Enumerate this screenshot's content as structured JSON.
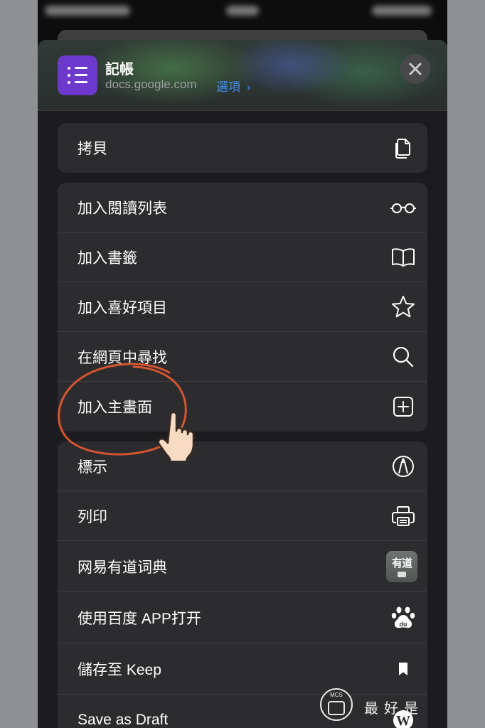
{
  "share_sheet": {
    "app_title": "記帳",
    "app_domain": "docs.google.com",
    "options_label": "選項",
    "options_chevron": "›",
    "close_symbol": "✕"
  },
  "groups": [
    {
      "items": [
        {
          "label": "拷貝",
          "icon": "copy-icon"
        }
      ]
    },
    {
      "items": [
        {
          "label": "加入閱讀列表",
          "icon": "glasses-icon"
        },
        {
          "label": "加入書籤",
          "icon": "book-icon"
        },
        {
          "label": "加入喜好項目",
          "icon": "star-icon"
        },
        {
          "label": "在網頁中尋找",
          "icon": "search-icon"
        },
        {
          "label": "加入主畫面",
          "icon": "add-square-icon"
        }
      ]
    },
    {
      "items": [
        {
          "label": "標示",
          "icon": "markup-pen-icon"
        },
        {
          "label": "列印",
          "icon": "printer-icon"
        },
        {
          "label": "网易有道词典",
          "icon": "youdao-app-icon",
          "icon_text": "有道"
        },
        {
          "label": "使用百度 APP打开",
          "icon": "baidu-paw-icon"
        },
        {
          "label": "儲存至 Keep",
          "icon": "bookmark-icon"
        },
        {
          "label": "Save as Draft",
          "icon": "wordpress-icon"
        }
      ]
    }
  ],
  "annotation": {
    "circle_color": "#d4552f",
    "target": "加入主畫面",
    "hand": "pointing-hand-icon"
  },
  "watermark": {
    "logo_text": "MCS",
    "text": "最好是"
  },
  "colors": {
    "sheet_bg": "#1c1c1e",
    "row_bg": "#2c2c2e",
    "accent_link": "#3d8df5",
    "app_icon_bg": "#6d39cc"
  }
}
